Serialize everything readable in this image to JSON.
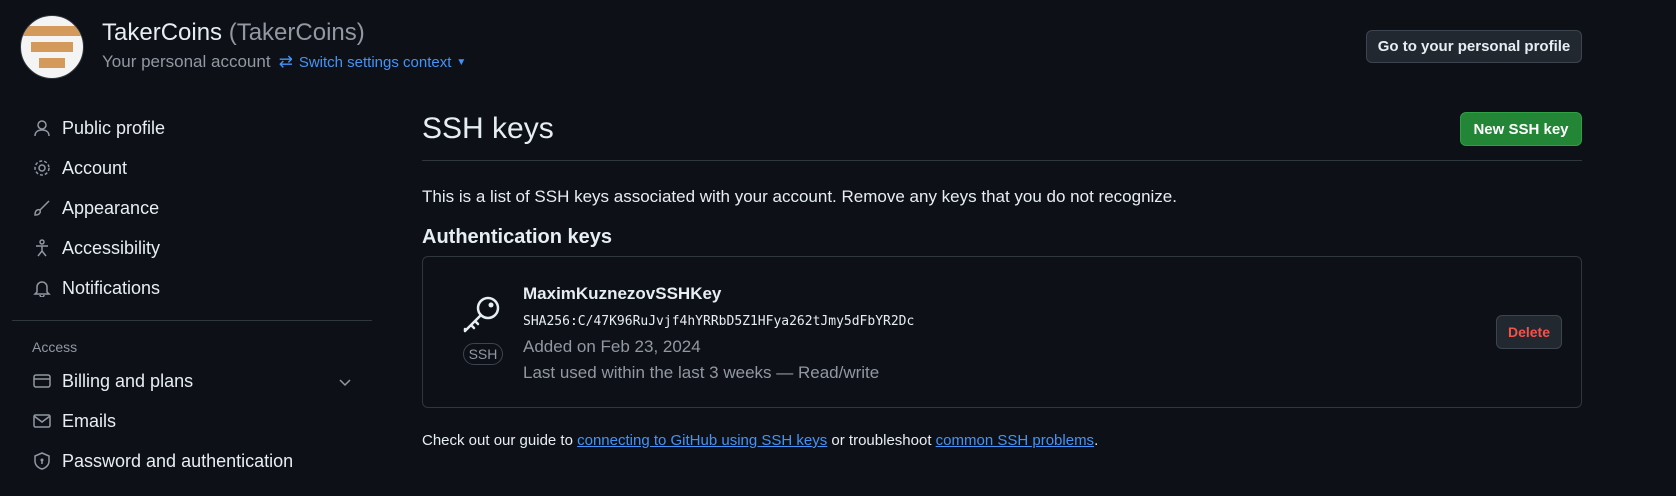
{
  "header": {
    "account_name": "TakerCoins",
    "account_handle": "(TakerCoins)",
    "account_type": "Your personal account",
    "switch_context": "Switch settings context",
    "go_profile_button": "Go to your personal profile"
  },
  "sidebar": {
    "items": [
      {
        "label": "Public profile",
        "icon": "person-icon"
      },
      {
        "label": "Account",
        "icon": "gear-icon"
      },
      {
        "label": "Appearance",
        "icon": "paintbrush-icon"
      },
      {
        "label": "Accessibility",
        "icon": "accessibility-icon"
      },
      {
        "label": "Notifications",
        "icon": "bell-icon"
      }
    ],
    "access_group_label": "Access",
    "access_items": [
      {
        "label": "Billing and plans",
        "icon": "credit-card-icon",
        "expandable": true
      },
      {
        "label": "Emails",
        "icon": "mail-icon"
      },
      {
        "label": "Password and authentication",
        "icon": "shield-lock-icon"
      }
    ]
  },
  "main": {
    "title": "SSH keys",
    "new_key_button": "New SSH key",
    "description": "This is a list of SSH keys associated with your account. Remove any keys that you do not recognize.",
    "section_heading": "Authentication keys",
    "keys": [
      {
        "title": "MaximKuznezovSSHKey",
        "fingerprint": "SHA256:C/47K96RuJvjf4hYRRbD5Z1HFya262tJmy5dFbYR2Dc",
        "badge": "SSH",
        "added": "Added on Feb 23, 2024",
        "last_used": "Last used within the last 3 weeks — Read/write",
        "delete_button": "Delete"
      }
    ],
    "footer": {
      "prefix": "Check out our guide to",
      "link1": "connecting to GitHub using SSH keys",
      "middle": "or troubleshoot",
      "link2": "common SSH problems",
      "suffix": "."
    }
  },
  "colors": {
    "background": "#0d1117",
    "accent_link": "#4493f8",
    "primary_button": "#238636",
    "danger": "#f85149"
  }
}
